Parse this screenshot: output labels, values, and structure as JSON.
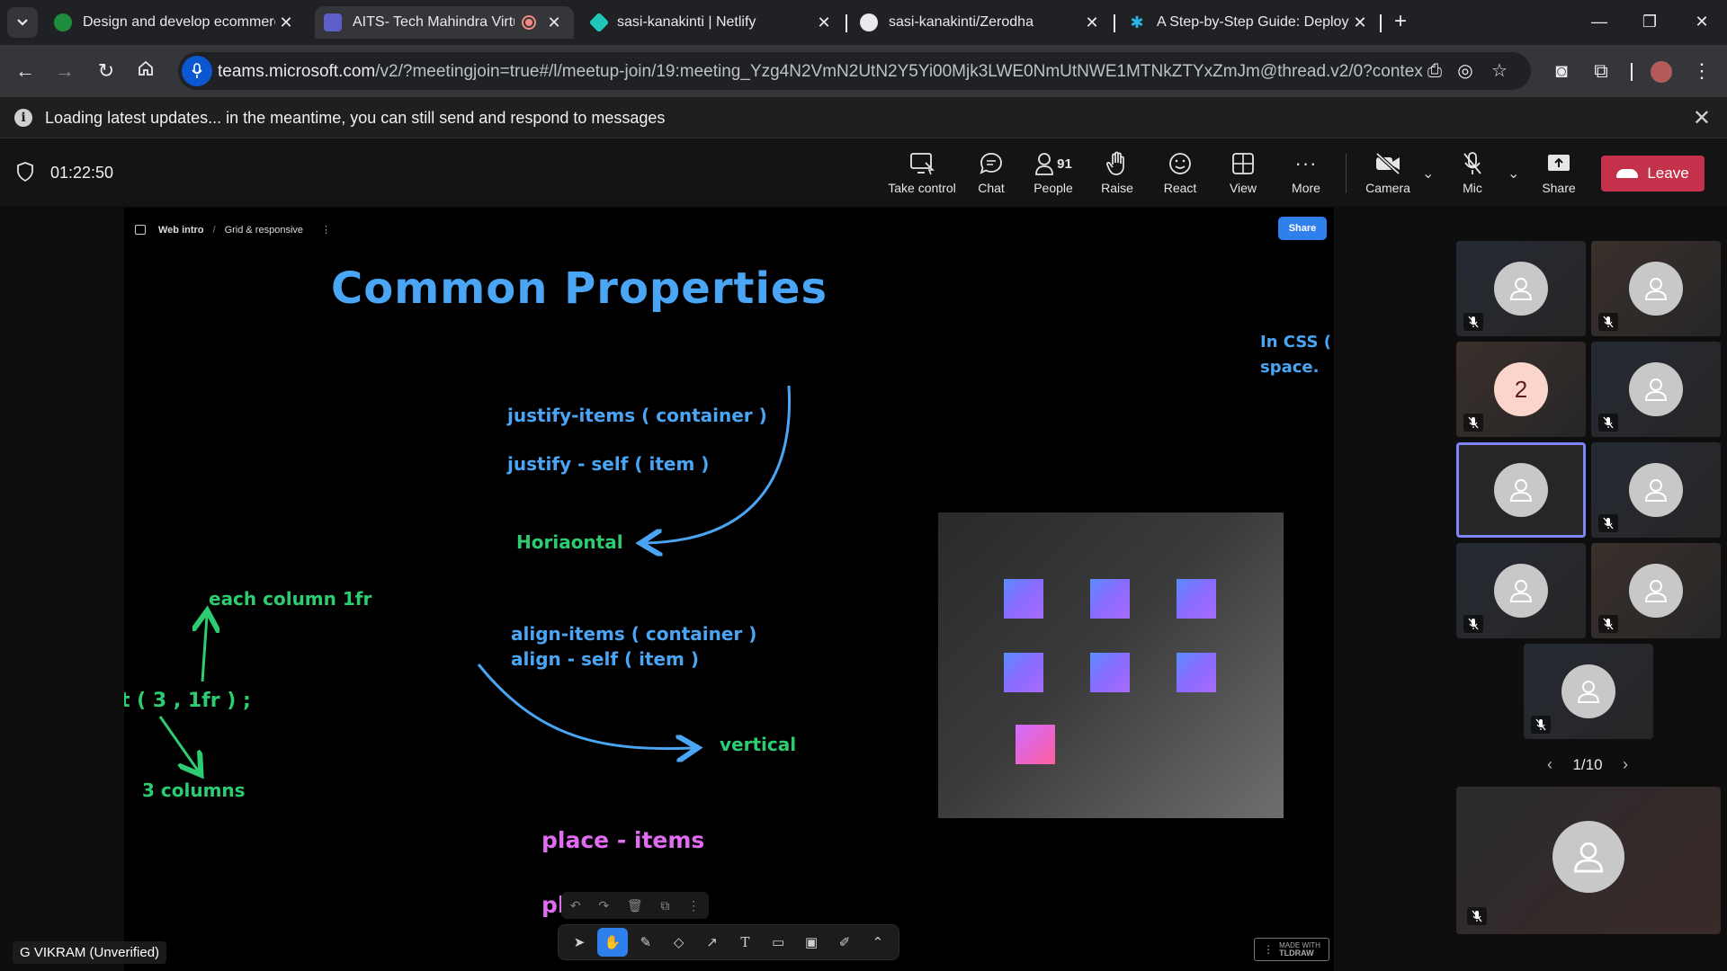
{
  "browser": {
    "tabs": [
      {
        "title": "Design and develop ecommerce",
        "fav_color": "#1e8e3e"
      },
      {
        "title": "AITS- Tech Mahindra Virtual",
        "fav_color": "#5b5fc7"
      },
      {
        "title": "sasi-kanakinti | Netlify",
        "fav_color": "#20c6b7"
      },
      {
        "title": "sasi-kanakinti/Zerodha",
        "fav_color": "#e8eaed"
      },
      {
        "title": "A Step-by-Step Guide: Deploying",
        "fav_color": "#2bb5e8"
      }
    ],
    "url_host": "teams.microsoft.com",
    "url_rest": "/v2/?meetingjoin=true#/l/meetup-join/19:meeting_Yzg4N2VmN2UtN2Y5Yi00Mjk3LWE0NmUtNWE1MTNkZTYxZmJm@thread.v2/0?context=%7b\"Tid..."
  },
  "infobar": {
    "message": "Loading latest updates... in the meantime, you can still send and respond to messages"
  },
  "meeting": {
    "timer": "01:22:50",
    "toolbar": {
      "take_control": "Take control",
      "chat": "Chat",
      "people": "People",
      "people_count": "91",
      "raise": "Raise",
      "react": "React",
      "view": "View",
      "more": "More",
      "camera": "Camera",
      "mic": "Mic",
      "share": "Share",
      "leave": "Leave"
    }
  },
  "whiteboard": {
    "breadcrumb_1": "Web intro",
    "breadcrumb_sep": "/",
    "breadcrumb_2": "Grid & responsive",
    "share_label": "Share",
    "title": "Common Properties",
    "justify_items": "justify-items  ( container )",
    "justify_self": "justify - self ( item )",
    "horizontal": "Horiaontal",
    "each_column": "each column 1fr",
    "repeat_expr": "t ( 3 , 1fr ) ;",
    "three_columns": "3 columns",
    "align_items": "align-items ( container )",
    "align_self": "align - self ( item )",
    "vertical": "vertical",
    "place_items": "place - items",
    "place_partial": "pl",
    "css_note_1": "In CSS (",
    "css_note_2": "space.",
    "badge_line1": "MADE WITH",
    "badge_line2": "TLDRAW"
  },
  "presenter": {
    "name": "G VIKRAM (Unverified)"
  },
  "participants": {
    "initial_tile": "2",
    "pager": "1/10"
  }
}
